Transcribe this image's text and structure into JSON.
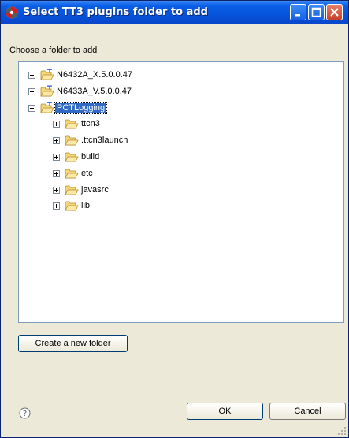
{
  "dialog": {
    "title": "Select TT3 plugins folder to add",
    "prompt": "Choose a folder to add"
  },
  "tree": {
    "items": [
      {
        "label": "N6432A_X.5.0.0.47",
        "level": 0,
        "expanded": false,
        "selected": false,
        "icon": "project-folder-icon"
      },
      {
        "label": "N6433A_V.5.0.0.47",
        "level": 0,
        "expanded": false,
        "selected": false,
        "icon": "project-folder-icon"
      },
      {
        "label": "PCTLogging",
        "level": 0,
        "expanded": true,
        "selected": true,
        "icon": "project-folder-icon"
      },
      {
        "label": "ttcn3",
        "level": 1,
        "expanded": false,
        "selected": false,
        "icon": "folder-icon"
      },
      {
        "label": ".ttcn3launch",
        "level": 1,
        "expanded": false,
        "selected": false,
        "icon": "folder-icon"
      },
      {
        "label": "build",
        "level": 1,
        "expanded": false,
        "selected": false,
        "icon": "folder-icon"
      },
      {
        "label": "etc",
        "level": 1,
        "expanded": false,
        "selected": false,
        "icon": "folder-icon"
      },
      {
        "label": "javasrc",
        "level": 1,
        "expanded": false,
        "selected": false,
        "icon": "folder-icon"
      },
      {
        "label": "lib",
        "level": 1,
        "expanded": false,
        "selected": false,
        "icon": "folder-icon"
      }
    ]
  },
  "buttons": {
    "create_folder": "Create a new folder",
    "ok": "OK",
    "cancel": "Cancel"
  },
  "colors": {
    "titlebar": "#0753db",
    "selection": "#316ac5"
  }
}
